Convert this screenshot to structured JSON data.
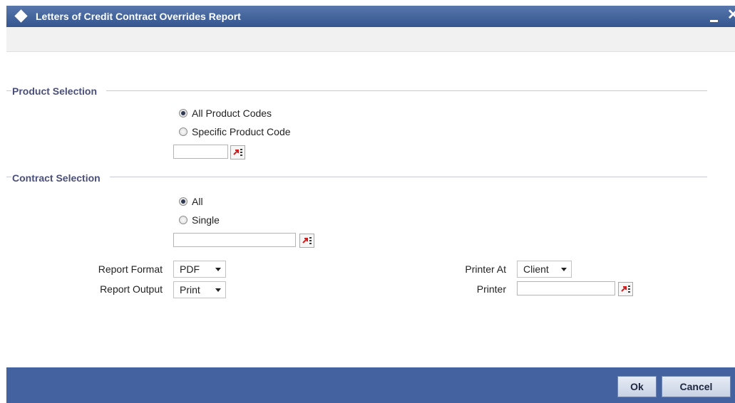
{
  "window": {
    "title": "Letters of Credit Contract Overrides Report",
    "minimize_label": "_",
    "close_label": "✕"
  },
  "product_selection": {
    "title": "Product Selection",
    "option_all": "All Product Codes",
    "option_specific": "Specific Product Code",
    "selected": "all",
    "code_value": ""
  },
  "contract_selection": {
    "title": "Contract Selection",
    "option_all": "All",
    "option_single": "Single",
    "selected": "all",
    "contract_value": ""
  },
  "report": {
    "format_label": "Report Format",
    "format_value": "PDF",
    "output_label": "Report Output",
    "output_value": "Print",
    "printer_at_label": "Printer At",
    "printer_at_value": "Client",
    "printer_label": "Printer",
    "printer_value": ""
  },
  "buttons": {
    "ok": "Ok",
    "cancel": "Cancel"
  },
  "colors": {
    "titlebar": "#34558f",
    "footer": "#4462a0",
    "section_title": "#4a4f7a",
    "lov_icon": "#d01c1c"
  }
}
